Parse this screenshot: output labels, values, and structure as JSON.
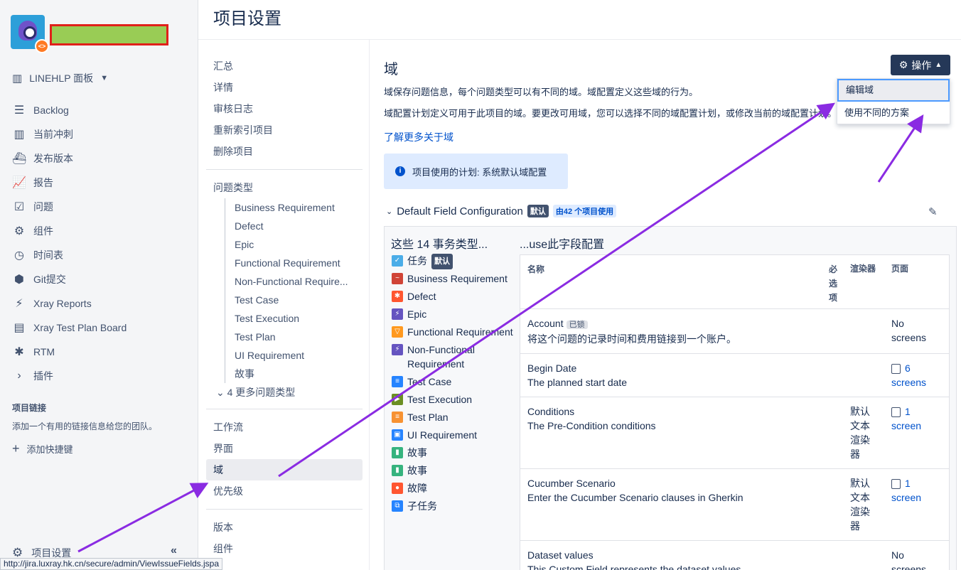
{
  "sidebar": {
    "board_label": "LINEHLP 面板",
    "items": [
      {
        "label": "Backlog",
        "icon": "backlog-icon"
      },
      {
        "label": "当前冲刺",
        "icon": "sprint-icon"
      },
      {
        "label": "发布版本",
        "icon": "ship-icon"
      },
      {
        "label": "报告",
        "icon": "reports-icon"
      },
      {
        "label": "问题",
        "icon": "issues-icon"
      },
      {
        "label": "组件",
        "icon": "components-icon"
      },
      {
        "label": "时间表",
        "icon": "clock-icon"
      },
      {
        "label": "Git提交",
        "icon": "git-icon"
      },
      {
        "label": "Xray Reports",
        "icon": "lightning-icon"
      },
      {
        "label": "Xray Test Plan Board",
        "icon": "board-icon"
      },
      {
        "label": "RTM",
        "icon": "bug-icon"
      },
      {
        "label": "插件",
        "icon": "chevron-right-icon"
      }
    ],
    "links_title": "项目链接",
    "links_desc": "添加一个有用的链接信息给您的团队。",
    "add_shortcut": "添加快捷键",
    "settings_label": "项目设置"
  },
  "status_url": "http://jira.luxray.hk.cn/secure/admin/ViewIssueFields.jspa",
  "page_title": "项目设置",
  "subnav": {
    "top": [
      "汇总",
      "详情",
      "审核日志",
      "重新索引项目",
      "删除项目"
    ],
    "issue_types_label": "问题类型",
    "issue_types": [
      "Business Requirement",
      "Defect",
      "Epic",
      "Functional Requirement",
      "Non-Functional Require...",
      "Test Case",
      "Test Execution",
      "Test Plan",
      "UI Requirement",
      "故事"
    ],
    "more_types": "4 更多问题类型",
    "middle": [
      "工作流",
      "界面",
      "域",
      "优先级"
    ],
    "bottom": [
      "版本",
      "组件"
    ]
  },
  "main": {
    "heading": "域",
    "desc1": "域保存问题信息，每个问题类型可以有不同的域。域配置定义这些域的行为。",
    "desc2": "域配置计划定义可用于此项目的域。要更改可用域，您可以选择不同的域配置计划，或修改当前的域配置计划。",
    "learn_more": "了解更多关于域",
    "info": "项目使用的计划: 系统默认域配置",
    "ops_button": "操作",
    "dropdown": [
      "编辑域",
      "使用不同的方案"
    ],
    "config_name": "Default Field Configuration",
    "default_badge": "默认",
    "used_by": "由42 个项目使用",
    "types_title": "这些 14 事务类型...",
    "use_title": "...use此字段配置",
    "types": [
      {
        "label": "任务",
        "color": "#4bade8",
        "badge": "默认"
      },
      {
        "label": "Business Requirement",
        "color": "#d04437"
      },
      {
        "label": "Defect",
        "color": "#ff5630"
      },
      {
        "label": "Epic",
        "color": "#6554c0"
      },
      {
        "label": "Functional Requirement",
        "color": "#ff991f"
      },
      {
        "label": "Non-Functional Requirement",
        "color": "#6554c0"
      },
      {
        "label": "Test Case",
        "color": "#2684ff"
      },
      {
        "label": "Test Execution",
        "color": "#6b8e23"
      },
      {
        "label": "Test Plan",
        "color": "#f79232"
      },
      {
        "label": "UI Requirement",
        "color": "#2684ff"
      },
      {
        "label": "故事",
        "color": "#36b37e"
      },
      {
        "label": "故事",
        "color": "#36b37e"
      },
      {
        "label": "故障",
        "color": "#ff5630"
      },
      {
        "label": "子任务",
        "color": "#2684ff"
      }
    ],
    "table": {
      "headers": {
        "name": "名称",
        "required": "必选项",
        "renderer": "渲染器",
        "screens": "页面"
      },
      "rows": [
        {
          "name": "Account",
          "badge": "已锁",
          "desc": "将这个问题的记录时间和费用链接到一个账户。",
          "renderer": "",
          "screens_num": "",
          "screens_text": "No screens"
        },
        {
          "name": "Begin Date",
          "badge": "",
          "desc": "The planned start date",
          "renderer": "",
          "screens_num": "6",
          "screens_text": "screens"
        },
        {
          "name": "Conditions",
          "badge": "",
          "desc": "The Pre-Condition conditions",
          "renderer": "默认文本渲染器",
          "screens_num": "1",
          "screens_text": "screen"
        },
        {
          "name": "Cucumber Scenario",
          "badge": "",
          "desc": "Enter the Cucumber Scenario clauses in Gherkin",
          "renderer": "默认文本渲染器",
          "screens_num": "1",
          "screens_text": "screen"
        },
        {
          "name": "Dataset values",
          "badge": "",
          "desc": "This Custom Field represents the dataset values",
          "renderer": "",
          "screens_num": "",
          "screens_text": "No screens"
        }
      ]
    }
  },
  "colors": {
    "annotation_arrow": "#8a2be2",
    "dark_button": "#253858",
    "link": "#0052cc"
  }
}
